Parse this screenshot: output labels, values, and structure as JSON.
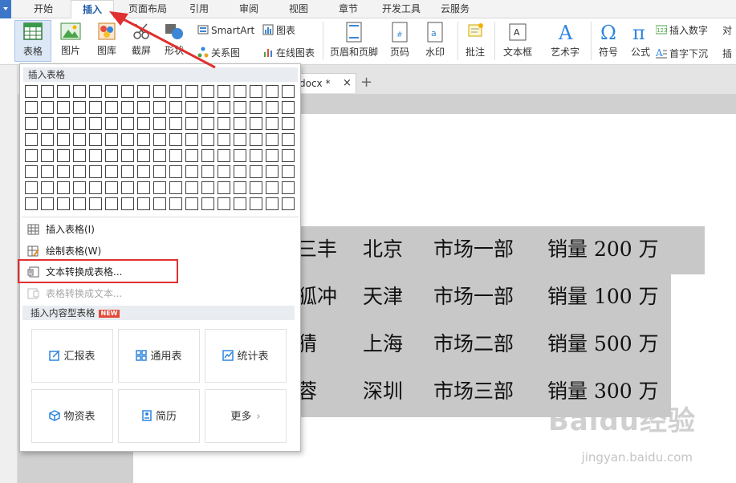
{
  "menu_tabs": [
    "开始",
    "插入",
    "页面布局",
    "引用",
    "审阅",
    "视图",
    "章节",
    "开发工具",
    "云服务"
  ],
  "ribbon": {
    "table": "表格",
    "picture": "图片",
    "gallery": "图库",
    "screenshot": "截屏",
    "shapes": "形状",
    "smartart": "SmartArt",
    "chart": "图表",
    "relation": "关系图",
    "online_chart": "在线图表",
    "header_footer": "页眉和页脚",
    "page_number": "页码",
    "watermark": "水印",
    "comment": "批注",
    "textbox": "文本框",
    "wordart": "艺术字",
    "symbol": "符号",
    "formula": "公式",
    "insert_number": "插入数字",
    "dropcap": "首字下沉",
    "cut_right_1": "对",
    "cut_right_2": "插"
  },
  "doc_tab": {
    "name": "docx *",
    "close": "×",
    "new": "+"
  },
  "dropdown": {
    "header": "插入表格",
    "items": [
      {
        "label": "插入表格(I)",
        "disabled": false
      },
      {
        "label": "绘制表格(W)",
        "disabled": false
      },
      {
        "label": "文本转换成表格...",
        "disabled": false
      },
      {
        "label": "表格转换成文本...",
        "disabled": true
      }
    ],
    "section": "插入内容型表格",
    "new_badge": "NEW",
    "cards": [
      "汇报表",
      "通用表",
      "统计表",
      "物资表",
      "简历",
      "更多"
    ]
  },
  "document_rows": [
    [
      "三丰",
      "北京",
      "市场一部",
      "销量 200 万"
    ],
    [
      "狐冲",
      "天津",
      "市场一部",
      "销量 100 万"
    ],
    [
      "猜",
      "上海",
      "市场二部",
      "销量 500 万"
    ],
    [
      "蓉",
      "深圳",
      "市场三部",
      "销量 300 万"
    ]
  ],
  "watermark": {
    "main": "Baidu经验",
    "sub": "jingyan.baidu.com"
  },
  "colors": {
    "accent": "#1e5aa8",
    "highlight_box": "#e03030",
    "arrow": "#e03030",
    "selection": "#c8c8c8"
  }
}
